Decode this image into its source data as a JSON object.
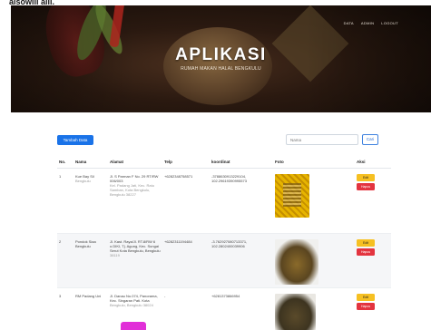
{
  "caption_fragment": "aisowiii aiii.",
  "hero": {
    "title": "APLIKASI",
    "subtitle": "RUMAH MAKAN HALAL BENGKULU",
    "nav": [
      "DATA",
      "ADMIN",
      "LOGOUT"
    ]
  },
  "toolbar": {
    "add_label": "Tambah Data",
    "search_placeholder": "Nama",
    "search_button": "Cari"
  },
  "table": {
    "headers": [
      "No.",
      "Nama",
      "Alamat",
      "Telp",
      "koordinat",
      "Foto",
      "Aksi"
    ],
    "rows": [
      {
        "no": "1",
        "nama": "Kue Bay Sil",
        "nama_sub": "Bengkulu",
        "alamat": "Jl. S Parman F No. 29 RT/RW 006/003",
        "alamat_sub": "Kel. Padang Jati, Kec. Ratu Samban, Kota Bengkulu, Bengkulu 38227",
        "telp": "+6282348758571",
        "koordinat": "-3788630913229104, 102.29619390995573"
      },
      {
        "no": "2",
        "nama": "Pondok Siaa Bengkulu",
        "nama_sub": "",
        "alamat": "Jl. Kast. Raya/Jl. RT.8/RW 6 o.DIKI, Tj. Agung, Kec. Sungai Serut Kota Bengkulu, Bengkulu",
        "alamat_sub": "38119",
        "telp": "+6282311194484",
        "koordinat": "-3.762927080713371, 102.2802400039906"
      },
      {
        "no": "3",
        "nama": "RM Padang Uni",
        "nama_sub": "",
        "alamat": "Jl. Danau No.074, Panorama, Kec. Singaran Pati. Kota",
        "alamat_sub": "Bengkulu, Bengkulu 38024",
        "telp": "-",
        "koordinat": "+6281373866954"
      }
    ],
    "edit_label": "Edit",
    "delete_label": "Hapus"
  },
  "colors": {
    "primary": "#1a73e8",
    "edit": "#f6c022",
    "delete": "#e3343f",
    "pink_marker": "#e12fd8"
  }
}
